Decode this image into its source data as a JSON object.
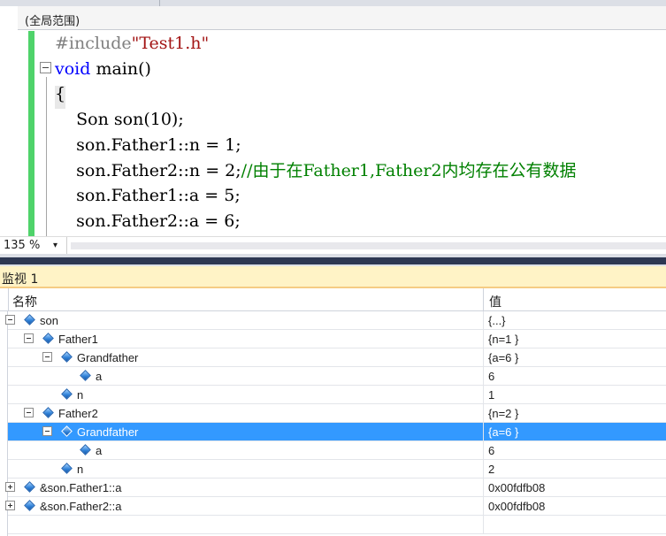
{
  "scope": {
    "label": "(全局范围)"
  },
  "editor": {
    "lines": [
      {
        "parts": [
          {
            "cls": "pp",
            "text": "#include"
          },
          {
            "cls": "str",
            "text": "\"Test1.h\""
          }
        ]
      },
      {
        "parts": [
          {
            "cls": "kw",
            "text": "void"
          },
          {
            "cls": "",
            "text": " main()"
          }
        ]
      },
      {
        "parts": [
          {
            "cls": "",
            "text": "{"
          }
        ]
      },
      {
        "parts": [
          {
            "cls": "",
            "text": "    Son son(10);"
          }
        ]
      },
      {
        "parts": [
          {
            "cls": "",
            "text": "    son.Father1::n = 1;"
          }
        ]
      },
      {
        "parts": [
          {
            "cls": "",
            "text": "    son.Father2::n = 2;"
          },
          {
            "cls": "cm",
            "text": "//由于在Father1,Father2内均存在公有数据"
          }
        ]
      },
      {
        "parts": [
          {
            "cls": "",
            "text": "    son.Father1::a = 5;"
          }
        ]
      },
      {
        "parts": [
          {
            "cls": "",
            "text": "    son.Father2::a = 6;"
          }
        ]
      }
    ]
  },
  "zoom": {
    "value": "135 %",
    "arrow": "▾"
  },
  "watch": {
    "title": "监视 1",
    "columns": {
      "name": "名称",
      "value": "值"
    },
    "rows": [
      {
        "label": "son",
        "value": "{...}",
        "depth": 0,
        "expander": "minus",
        "selected": false
      },
      {
        "label": "Father1",
        "value": "{n=1 }",
        "depth": 1,
        "expander": "minus",
        "selected": false
      },
      {
        "label": "Grandfather",
        "value": "{a=6 }",
        "depth": 2,
        "expander": "minus",
        "selected": false
      },
      {
        "label": "a",
        "value": "6",
        "depth": 3,
        "expander": "none",
        "selected": false
      },
      {
        "label": "n",
        "value": "1",
        "depth": 2,
        "expander": "none",
        "selected": false
      },
      {
        "label": "Father2",
        "value": "{n=2 }",
        "depth": 1,
        "expander": "minus",
        "selected": false
      },
      {
        "label": "Grandfather",
        "value": "{a=6 }",
        "depth": 2,
        "expander": "minus",
        "selected": true
      },
      {
        "label": "a",
        "value": "6",
        "depth": 3,
        "expander": "none",
        "selected": false
      },
      {
        "label": "n",
        "value": "2",
        "depth": 2,
        "expander": "none",
        "selected": false
      },
      {
        "label": "&son.Father1::a",
        "value": "0x00fdfb08",
        "depth": 0,
        "expander": "plus",
        "selected": false
      },
      {
        "label": "&son.Father2::a",
        "value": "0x00fdfb08",
        "depth": 0,
        "expander": "plus",
        "selected": false
      }
    ]
  },
  "colors": {
    "selection": "#3399ff",
    "keyword": "#0000ff",
    "string": "#a31515",
    "comment": "#008000",
    "change_margin": "#4fd36a",
    "watch_tab": "#fff3c6"
  }
}
